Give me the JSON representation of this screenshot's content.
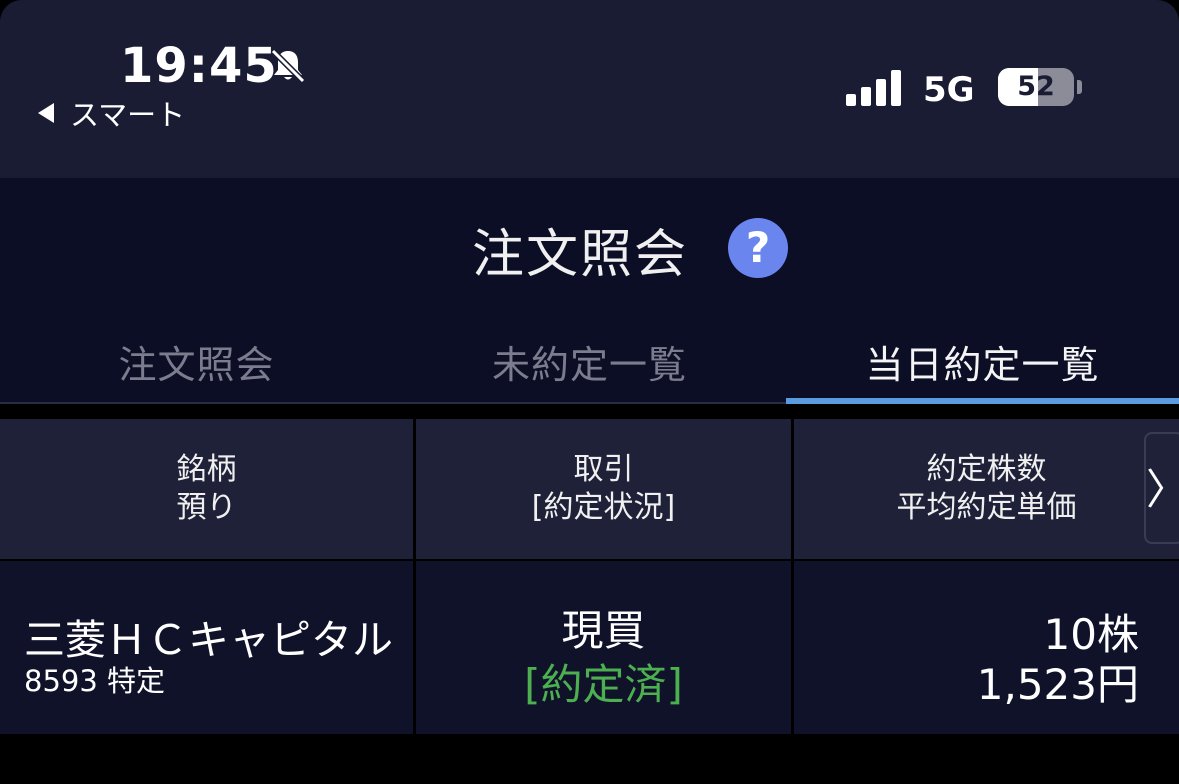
{
  "status_bar": {
    "time": "19:45",
    "back_app": "スマート",
    "network": "5G",
    "battery_level": "52",
    "battery_fraction": 0.52
  },
  "header": {
    "title": "注文照会",
    "help_symbol": "?"
  },
  "tabs": [
    {
      "label": "注文照会",
      "active": false
    },
    {
      "label": "未約定一覧",
      "active": false
    },
    {
      "label": "当日約定一覧",
      "active": true
    }
  ],
  "table": {
    "headers": [
      {
        "line1": "銘柄",
        "line2": "預り"
      },
      {
        "line1": "取引",
        "line2": "[約定状況]"
      },
      {
        "line1": "約定株数",
        "line2": "平均約定単価"
      }
    ],
    "scroll_arrow": "〉",
    "rows": [
      {
        "name": "三菱ＨＣキャピタル",
        "code_account": "8593 特定",
        "trade_type": "現買",
        "status": "[約定済]",
        "quantity": "10株",
        "avg_price": "1,523円"
      }
    ]
  },
  "colors": {
    "accent_tab": "#5a9be0",
    "status_executed": "#4caf50",
    "help_bg": "#6a86ee"
  }
}
